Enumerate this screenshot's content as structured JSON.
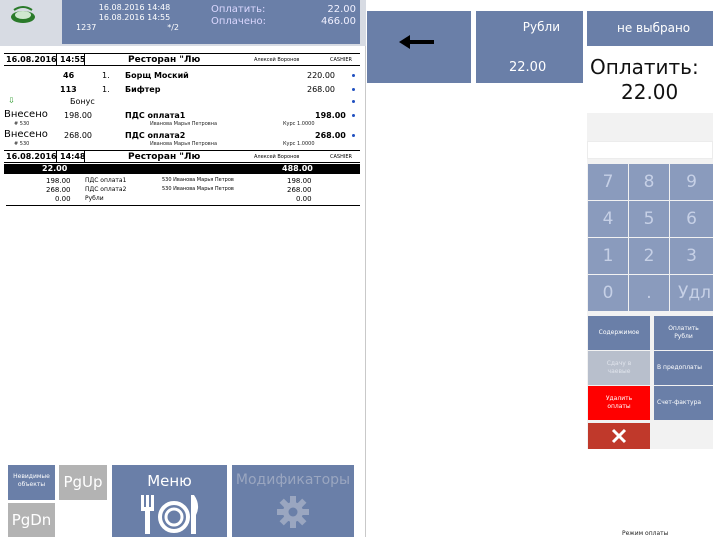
{
  "header": {
    "datetime_1": "16.08.2016 14:48",
    "datetime_2": "16.08.2016 14:55",
    "order_no": "1237",
    "table_no": "*/2",
    "pay_label": "Оплатить:",
    "pay_value": "22.00",
    "paid_label": "Оплачено:",
    "paid_value": "466.00"
  },
  "order_1": {
    "date": "16.08.2016",
    "time": "14:55",
    "place": "Ресторан \"Лю",
    "waiter": "Алексей Воронов",
    "cashier": "CASHIER"
  },
  "items": [
    {
      "code": "46",
      "qty": "1.",
      "name": "Борщ Моский",
      "price": "220.00"
    },
    {
      "code": "113",
      "qty": "1.",
      "name": "Бифтер",
      "price": "268.00"
    }
  ],
  "bonus_label": "Бонус",
  "payments": [
    {
      "label": "Внесено",
      "card": "# 530",
      "amount": "198.00",
      "method": "ПДС оплата1",
      "person": "Иванова Марья Петровна",
      "rate": "Курс 1.0000",
      "total": "198.00"
    },
    {
      "label": "Внесено",
      "card": "# 530",
      "amount": "268.00",
      "method": "ПДС оплата2",
      "person": "Иванова Марья Петровна",
      "rate": "Курс 1.0000",
      "total": "268.00"
    }
  ],
  "order_2": {
    "date": "16.08.2016",
    "time": "14:48",
    "place": "Ресторан \"Лю",
    "waiter": "Алексей Воронов",
    "cashier": "CASHIER"
  },
  "summary_bar": {
    "left": "22.00",
    "right": "488.00"
  },
  "summary_rows": [
    {
      "amount": "198.00",
      "method": "ПДС оплата1",
      "person": "530 Иванова Марья Петров",
      "total": "198.00"
    },
    {
      "amount": "268.00",
      "method": "ПДС оплата2",
      "person": "530 Иванова Марья Петров",
      "total": "268.00"
    },
    {
      "amount": "0.00",
      "method": "Рубли",
      "person": "",
      "total": "0.00"
    }
  ],
  "toolbar": {
    "objects_label_1": "Невидимые",
    "objects_label_2": "объекты",
    "pgup": "PgUp",
    "pgdn": "PgDn",
    "menu": "Меню",
    "modifiers": "Модификаторы"
  },
  "payment_panel": {
    "currency_label": "Рубли",
    "currency_value": "22.00",
    "not_chosen": "не выбрано",
    "pay_title": "Оплатить:",
    "pay_amount": "22.00",
    "keys": [
      "7",
      "8",
      "9",
      "4",
      "5",
      "6",
      "1",
      "2",
      "3",
      "0",
      ".",
      "Удл"
    ],
    "btn_contents": "Содержимое",
    "btn_pay_rubles_1": "Оплатить",
    "btn_pay_rubles_2": "Рубли",
    "btn_change_1": "Сдачу в",
    "btn_change_2": "чаевые",
    "btn_prepay": "В предоплаты",
    "btn_delete_1": "Удалить",
    "btn_delete_2": "оплаты",
    "btn_invoice": "Счет-фактура",
    "mode_label": "Режим оплаты"
  },
  "colors": {
    "accent": "#6a7fa8",
    "key": "#8a9bbd",
    "danger": "#ff0000",
    "close": "#c0392b"
  }
}
